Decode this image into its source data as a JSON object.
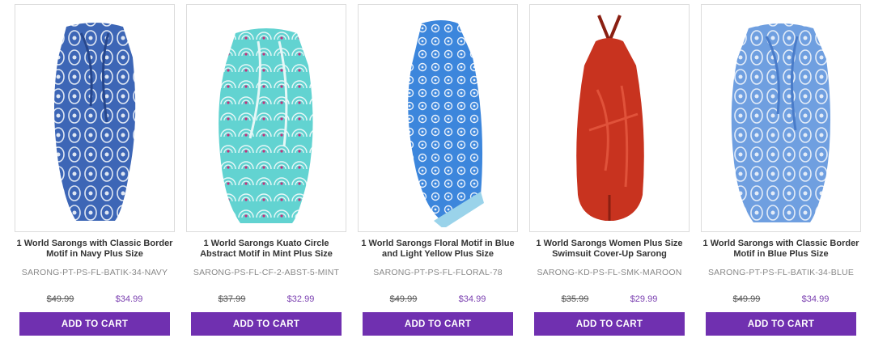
{
  "products": [
    {
      "title": "1 World Sarongs with Classic Border Motif in Navy Plus Size",
      "sku": "SARONG-PT-PS-FL-BATIK-34-NAVY",
      "old_price": "$49.99",
      "price": "$34.99",
      "cta": "ADD TO CART",
      "colors": {
        "base": "#3d66b6",
        "pattern": "#dfe7f3",
        "accent": "#27478c"
      }
    },
    {
      "title": "1 World Sarongs Kuato Circle Abstract Motif in Mint Plus Size",
      "sku": "SARONG-PS-FL-CF-2-ABST-5-MINT",
      "old_price": "$37.99",
      "price": "$32.99",
      "cta": "ADD TO CART",
      "colors": {
        "base": "#62d3d1",
        "pattern": "#e6f7f7",
        "accent": "#c4317c"
      }
    },
    {
      "title": "1 World Sarongs Floral Motif in Blue and Light Yellow Plus Size",
      "sku": "SARONG-PT-PS-FL-FLORAL-78",
      "old_price": "$49.99",
      "price": "$34.99",
      "cta": "ADD TO CART",
      "colors": {
        "base": "#3c86dc",
        "pattern": "#e8f0fa",
        "accent": "#9ad3ea"
      }
    },
    {
      "title": "1 World Sarongs Women Plus Size Swimsuit Cover-Up Sarong",
      "sku": "SARONG-KD-PS-FL-SMK-MAROON",
      "old_price": "$35.99",
      "price": "$29.99",
      "cta": "ADD TO CART",
      "colors": {
        "base": "#c8331f",
        "pattern": "#e0523a",
        "accent": "#8a1f12"
      }
    },
    {
      "title": "1 World Sarongs with Classic Border Motif in Blue Plus Size",
      "sku": "SARONG-PT-PS-FL-BATIK-34-BLUE",
      "old_price": "$49.99",
      "price": "$34.99",
      "cta": "ADD TO CART",
      "colors": {
        "base": "#6f9fe0",
        "pattern": "#e3ecf8",
        "accent": "#4a7cc9"
      }
    }
  ]
}
